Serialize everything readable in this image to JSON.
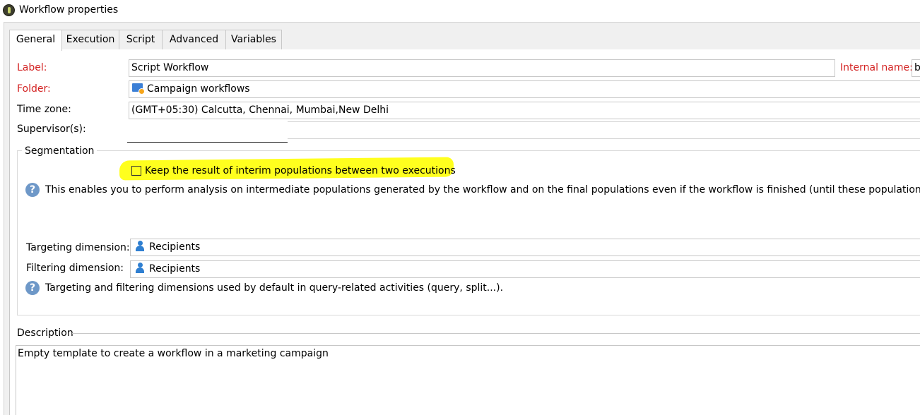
{
  "window": {
    "title": "Workflow properties"
  },
  "tabs": [
    {
      "label": "General",
      "active": true
    },
    {
      "label": "Execution",
      "active": false
    },
    {
      "label": "Script",
      "active": false
    },
    {
      "label": "Advanced",
      "active": false
    },
    {
      "label": "Variables",
      "active": false
    }
  ],
  "general": {
    "label_caption": "Label:",
    "label_value": "Script Workflow",
    "internal_name_caption": "Internal name:",
    "internal_name_value": "b",
    "folder_caption": "Folder:",
    "folder_value": "Campaign workflows",
    "timezone_caption": "Time zone:",
    "timezone_value": "(GMT+05:30) Calcutta, Chennai, Mumbai,New Delhi",
    "supervisor_caption": "Supervisor(s):",
    "supervisor_value": ""
  },
  "segmentation": {
    "legend": "Segmentation",
    "keep_result_label": "Keep the result of interim populations between two executions",
    "keep_result_checked": false,
    "keep_result_help": "This enables you to perform analysis on intermediate populations generated by the workflow and on the final populations even if the workflow is finished (until these populations are purge",
    "targeting_caption": "Targeting dimension:",
    "targeting_value": "Recipients",
    "filtering_caption": "Filtering dimension:",
    "filtering_value": "Recipients",
    "dimensions_help": "Targeting and filtering dimensions used by default in query-related activities (query, split...)."
  },
  "description": {
    "legend": "Description",
    "text": "Empty template to create a workflow in a marketing campaign"
  },
  "colors": {
    "required_label": "#d32222",
    "highlight": "#ffff1e",
    "help_icon": "#6e98c8",
    "user_icon": "#2f7fd1"
  }
}
